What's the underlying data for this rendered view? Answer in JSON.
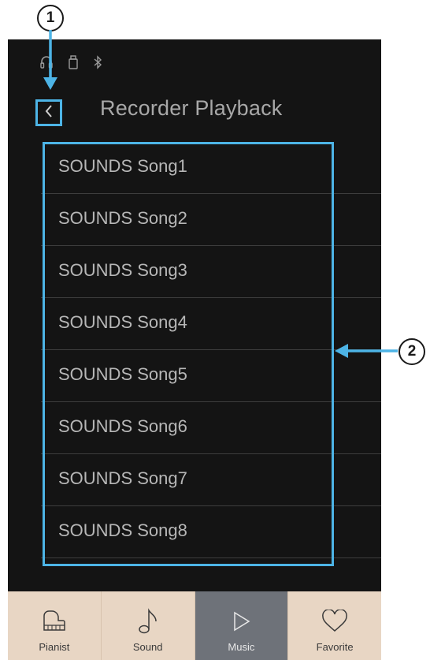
{
  "callouts": {
    "one": "1",
    "two": "2"
  },
  "screen": {
    "status_icons": [
      "headphones-icon",
      "usb-memory-icon",
      "bluetooth-icon"
    ],
    "header": {
      "title": "Recorder Playback",
      "back_icon": "chevron-left-icon"
    },
    "songs": [
      "SOUNDS Song1",
      "SOUNDS Song2",
      "SOUNDS Song3",
      "SOUNDS Song4",
      "SOUNDS Song5",
      "SOUNDS Song6",
      "SOUNDS Song7",
      "SOUNDS Song8"
    ],
    "tabs": [
      {
        "label": "Pianist",
        "icon": "piano-icon",
        "active": false
      },
      {
        "label": "Sound",
        "icon": "music-note-icon",
        "active": false
      },
      {
        "label": "Music",
        "icon": "play-triangle-icon",
        "active": true
      },
      {
        "label": "Favorite",
        "icon": "heart-icon",
        "active": false
      }
    ]
  },
  "colors": {
    "screen_background": "#141414",
    "highlight": "#4db4e6",
    "tab_bar": "#e8d6c4",
    "tab_active": "#6e7279",
    "text_list": "#b7b7b7"
  }
}
